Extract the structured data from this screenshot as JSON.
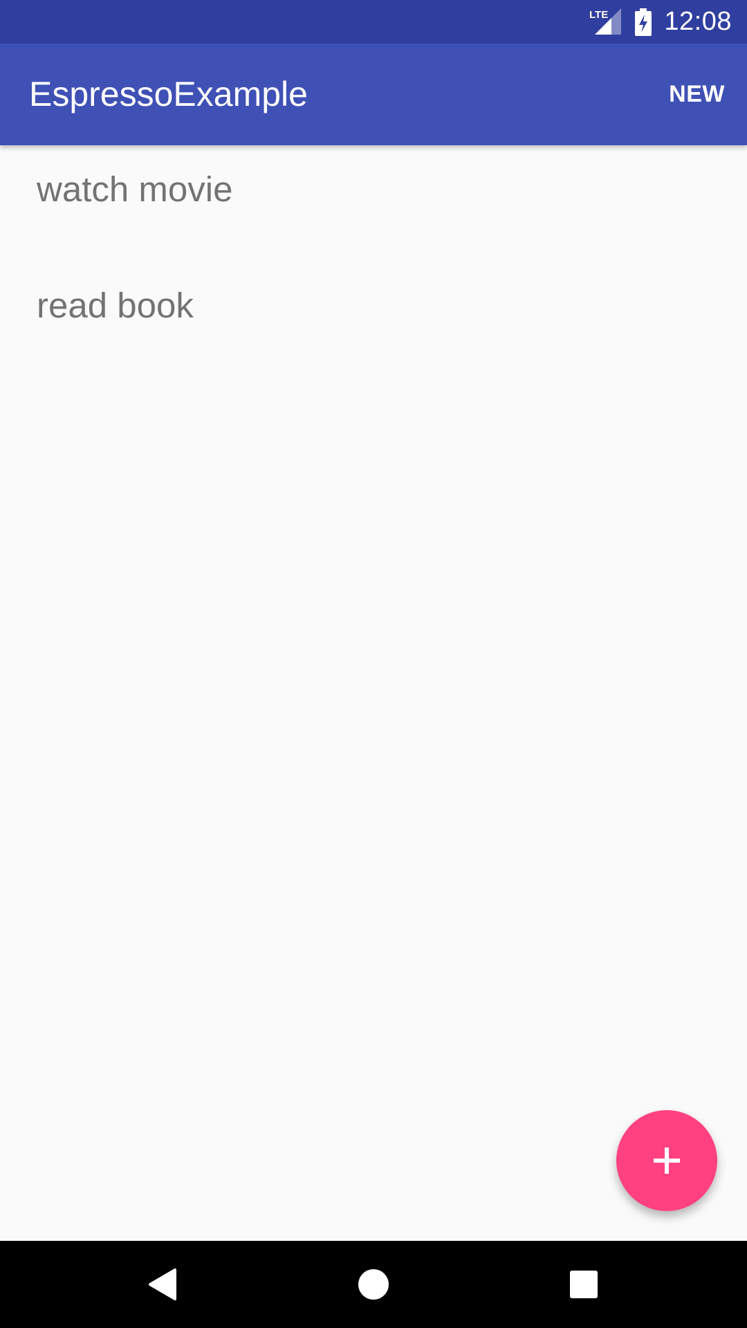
{
  "status_bar": {
    "time": "12:08",
    "network_label": "LTE",
    "icons": [
      "lte-signal-icon",
      "battery-charging-icon"
    ]
  },
  "app_bar": {
    "title": "EspressoExample",
    "action_new_label": "NEW"
  },
  "list": {
    "items": [
      {
        "label": "watch movie"
      },
      {
        "label": "read book"
      }
    ]
  },
  "fab": {
    "icon": "plus-icon",
    "color": "#ff4081"
  },
  "nav_bar": {
    "buttons": [
      "back-icon",
      "home-icon",
      "recents-icon"
    ]
  },
  "colors": {
    "primary": "#3f51b5",
    "primary_dark": "#303f9f",
    "accent": "#ff4081",
    "background": "#fafafa",
    "list_text": "#737373"
  }
}
